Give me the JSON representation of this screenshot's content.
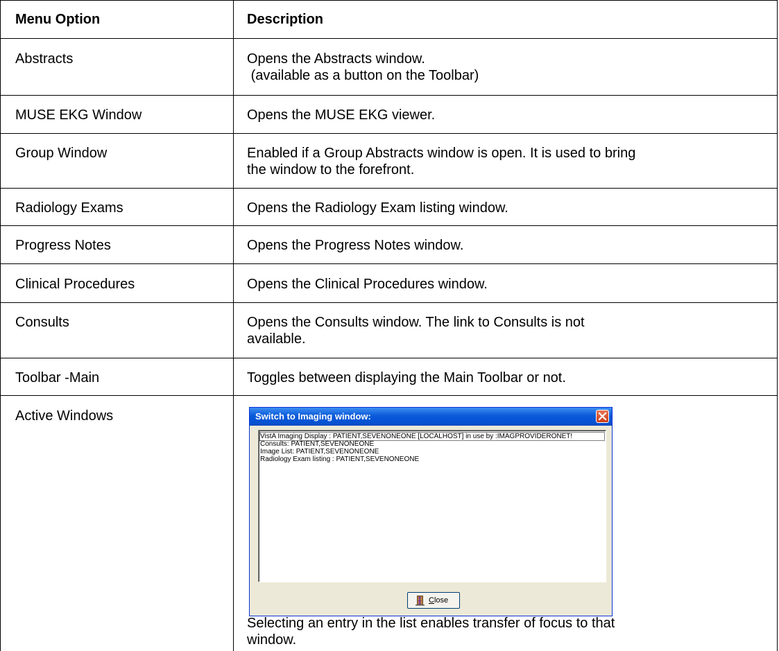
{
  "table": {
    "headers": [
      "Menu Option",
      "Description"
    ],
    "rows": [
      {
        "option": "Abstracts",
        "description": "Opens the Abstracts window.\n (available as a button on the Toolbar)"
      },
      {
        "option": "MUSE EKG Window",
        "description": "Opens the MUSE EKG viewer."
      },
      {
        "option": "Group Window",
        "description": "Enabled if a Group Abstracts window is open. It is used to bring\nthe window to the forefront."
      },
      {
        "option": "Radiology Exams",
        "description": "Opens the Radiology Exam listing window."
      },
      {
        "option": "Progress Notes",
        "description": "Opens the Progress Notes window."
      },
      {
        "option": "Clinical Procedures",
        "description": "Opens the Clinical Procedures window."
      },
      {
        "option": "Consults",
        "description": "Opens the Consults window. The link to Consults is not\navailable."
      },
      {
        "option": "Toolbar -Main",
        "description": "Toggles between displaying the Main Toolbar or not."
      },
      {
        "option": "Active Windows",
        "description": "Selecting an entry in the list enables transfer of focus to that\nwindow."
      }
    ]
  },
  "dialog": {
    "title": "Switch to Imaging window:",
    "list_items": [
      "VistA Imaging Display : PATIENT,SEVENONEONE [LOCALHOST] in use by :IMAGPROVIDERONET!",
      "Consults: PATIENT,SEVENONEONE",
      "Image List: PATIENT,SEVENONEONE",
      "Radiology Exam listing  : PATIENT,SEVENONEONE"
    ],
    "close_button_label": "Close",
    "close_button_mnemonic": "C",
    "close_button_rest": "lose",
    "titlebar_color": "#0a5ad9",
    "close_x_color": "#cb3b14"
  }
}
